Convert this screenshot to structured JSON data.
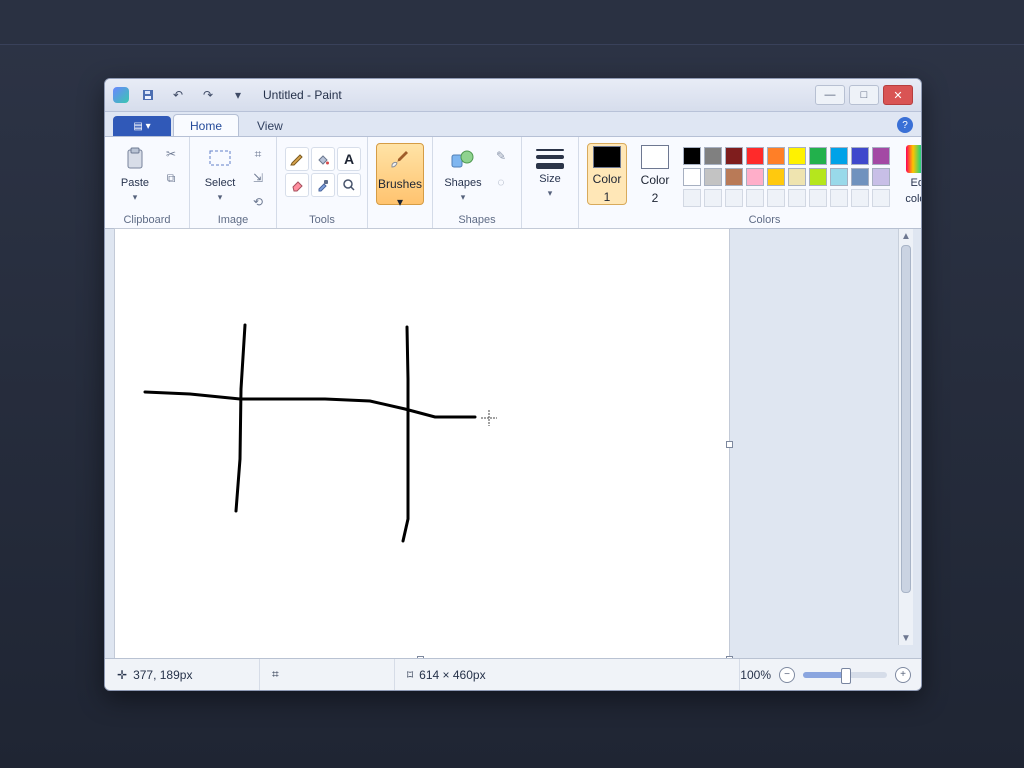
{
  "app": {
    "title": "Untitled - Paint"
  },
  "ribbon": {
    "tabs": [
      "Home",
      "View"
    ],
    "groups": {
      "clipboard": {
        "label": "Clipboard",
        "paste_label": "Paste"
      },
      "image": {
        "label": "Image",
        "select_label": "Select"
      },
      "tools": {
        "label": "Tools"
      },
      "brushes": {
        "label": "Brushes"
      },
      "shapes": {
        "label": "Shapes",
        "button_label": "Shapes"
      },
      "size": {
        "label": "Size"
      },
      "colors": {
        "label": "Colors",
        "color1_label": "Color",
        "color1_number": "1",
        "color2_label": "Color",
        "color2_number": "2",
        "edit_label": "Edit",
        "edit_sub": "colors"
      }
    }
  },
  "palette": {
    "row1": [
      "#000000",
      "#808080",
      "#7f1d1d",
      "#ff2a2a",
      "#ff7f27",
      "#fff200",
      "#22b14c",
      "#00a2e8",
      "#3f48cc",
      "#a349a4"
    ],
    "row2": [
      "#ffffff",
      "#c3c3c3",
      "#b97a57",
      "#ffaec9",
      "#ffc90e",
      "#efe4b0",
      "#b5e61d",
      "#99d9ea",
      "#7092be",
      "#c8bfe7"
    ],
    "row3": [
      "",
      "",
      "",
      "",
      "",
      "",
      "",
      "",
      "",
      ""
    ],
    "color1": "#000000",
    "color2": "#ffffff"
  },
  "status": {
    "cursor": "377, 189px",
    "canvas_size": "614 × 460px",
    "zoom": "100%",
    "zoom_fraction": 0.5
  }
}
